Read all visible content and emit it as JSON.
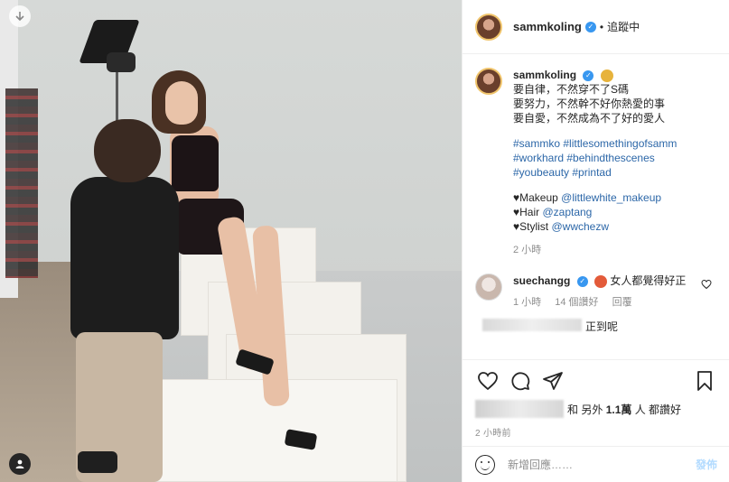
{
  "header": {
    "username": "sammkoling",
    "separator": "•",
    "follow_status": "追蹤中"
  },
  "caption": {
    "username": "sammkoling",
    "lines": [
      "要自律，不然穿不了S碼",
      "要努力，不然幹不好你熱愛的事",
      "要自愛，不然成為不了好的愛人"
    ],
    "hashtags": [
      "#sammko #littlesomethingofsamm",
      "#workhard #behindthescenes",
      "#youbeauty #printad"
    ],
    "credits": [
      {
        "label": "♥Makeup ",
        "tag": "@littlewhite_makeup"
      },
      {
        "label": "♥Hair ",
        "tag": "@zaptang"
      },
      {
        "label": "♥Stylist ",
        "tag": "@wwchezw"
      }
    ],
    "time": "2 小時"
  },
  "comment1": {
    "username": "suechangg",
    "text": "女人都覺得好正",
    "time": "1 小時",
    "likes": "14 個讚好",
    "reply": "回覆"
  },
  "comment2_partial": {
    "text": "正到呢"
  },
  "likes": {
    "prefix": "和 另外",
    "count": "1.1萬",
    "suffix": "人 都讚好"
  },
  "posted": "2 小時前",
  "add_comment": {
    "placeholder": "新增回應……",
    "post_label": "發佈"
  },
  "colors": {
    "link": "#2c67a8",
    "verified": "#3897f0",
    "muted": "#8e8e8e"
  }
}
